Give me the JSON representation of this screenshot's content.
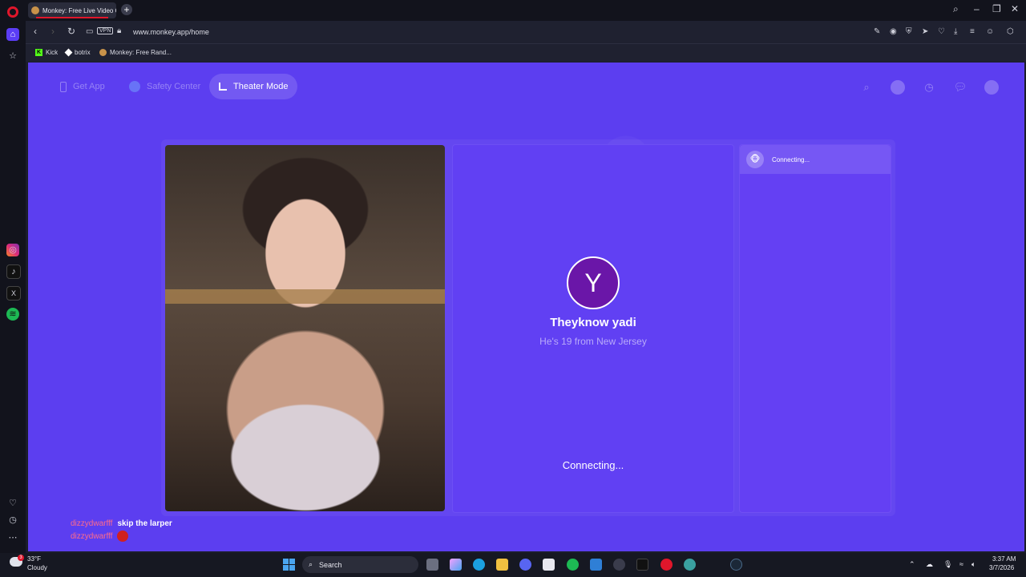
{
  "browser": {
    "tab_title": "Monkey: Free Live Video C",
    "url": "www.monkey.app/home",
    "vpn_label": "VPN",
    "bookmarks": [
      "Kick",
      "botrix",
      "Monkey: Free Rand..."
    ]
  },
  "site": {
    "nav": {
      "get_app": "Get App",
      "safety_center": "Safety Center",
      "theater_mode": "Theater Mode"
    },
    "match": {
      "avatar_letter": "Y",
      "name": "Theyknow yadi",
      "info": "He's 19 from New Jersey",
      "status": "Connecting..."
    },
    "chat": {
      "status": "Connecting..."
    }
  },
  "overlay_chat": [
    {
      "user": "dizzydwarfff",
      "message": "skip the larper"
    },
    {
      "user": "dizzydwarfff",
      "message": ""
    }
  ],
  "taskbar": {
    "temperature": "33°F",
    "condition": "Cloudy",
    "weather_badge": "3",
    "search_label": "Search",
    "time": "3:37 AM",
    "date": "3/7/2026"
  },
  "colors": {
    "page_bg": "#5c3ef0",
    "avatar_bg": "#6a16a8",
    "chat_user": "#ff6b8a",
    "opera_red": "#e0162b"
  }
}
